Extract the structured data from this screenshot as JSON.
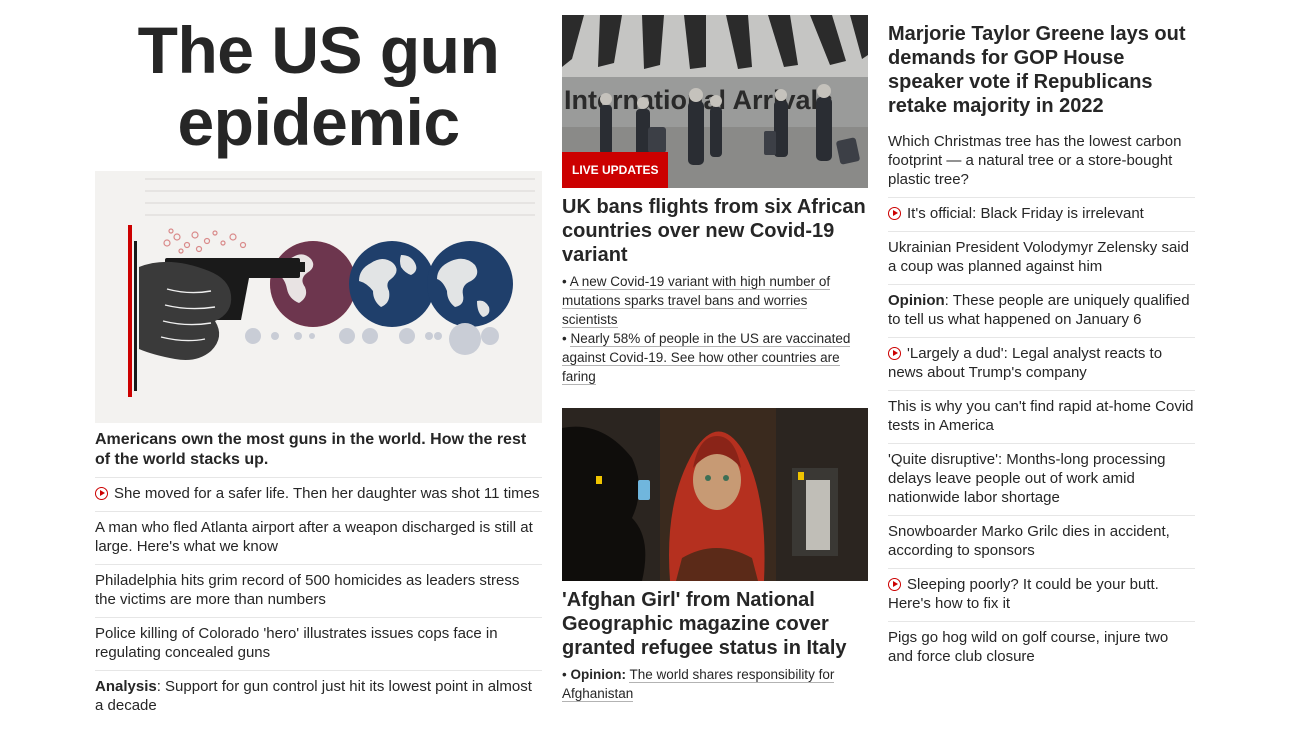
{
  "col1": {
    "big_title": "The US gun epidemic",
    "lead_headline": "Americans own the most guns in the world. How the rest of the world stacks up.",
    "items": [
      {
        "video": true,
        "text": "She moved for a safer life. Then her daughter was shot 11 times"
      },
      {
        "text": "A man who fled Atlanta airport after a weapon discharged is still at large. Here's what we know"
      },
      {
        "text": "Philadelphia hits grim record of 500 homicides as leaders stress the victims are more than numbers"
      },
      {
        "text": "Police killing of Colorado 'hero' illustrates issues cops face in regulating concealed guns"
      },
      {
        "prefix": "Analysis",
        "text": ": Support for gun control just hit its lowest point in almost a decade"
      }
    ]
  },
  "col2": {
    "story1": {
      "image_sign": "International Arrivals",
      "badge": "LIVE UPDATES",
      "headline": "UK bans flights from six African countries over new Covid-19 variant",
      "bullets": [
        "A new Covid-19 variant with high number of mutations sparks travel bans and worries scientists",
        "Nearly 58% of people in the US are vaccinated against Covid-19. See how other countries are faring"
      ]
    },
    "story2": {
      "headline": "'Afghan Girl' from National Geographic magazine cover granted refugee status in Italy",
      "bullet_prefix": "Opinion:",
      "bullet_text": "The world shares responsibility for Afghanistan"
    }
  },
  "col3": {
    "headline": "Marjorie Taylor Greene lays out demands for GOP House speaker vote if Republicans retake majority in 2022",
    "items": [
      {
        "text": "Which Christmas tree has the lowest carbon footprint — a natural tree or a store-bought plastic tree?"
      },
      {
        "video": true,
        "text": "It's official: Black Friday is irrelevant"
      },
      {
        "text": "Ukrainian President Volodymyr Zelensky said a coup was planned against him"
      },
      {
        "prefix": "Opinion",
        "text": ": These people are uniquely qualified to tell us what happened on January 6"
      },
      {
        "video": true,
        "text": "'Largely a dud': Legal analyst reacts to news about Trump's company"
      },
      {
        "text": "This is why you can't find rapid at-home Covid tests in America"
      },
      {
        "text": "'Quite disruptive': Months-long processing delays leave people out of work amid nationwide labor shortage"
      },
      {
        "text": "Snowboarder Marko Grilc dies in accident, according to sponsors"
      },
      {
        "video": true,
        "text": "Sleeping poorly? It could be your butt. Here's how to fix it"
      },
      {
        "text": "Pigs go hog wild on golf course, injure two and force club closure"
      }
    ]
  },
  "colors": {
    "accent_red": "#cc0000",
    "text_dark": "#262626",
    "divider": "#e6e6e6",
    "globe_blue": "#1f3f6b"
  }
}
